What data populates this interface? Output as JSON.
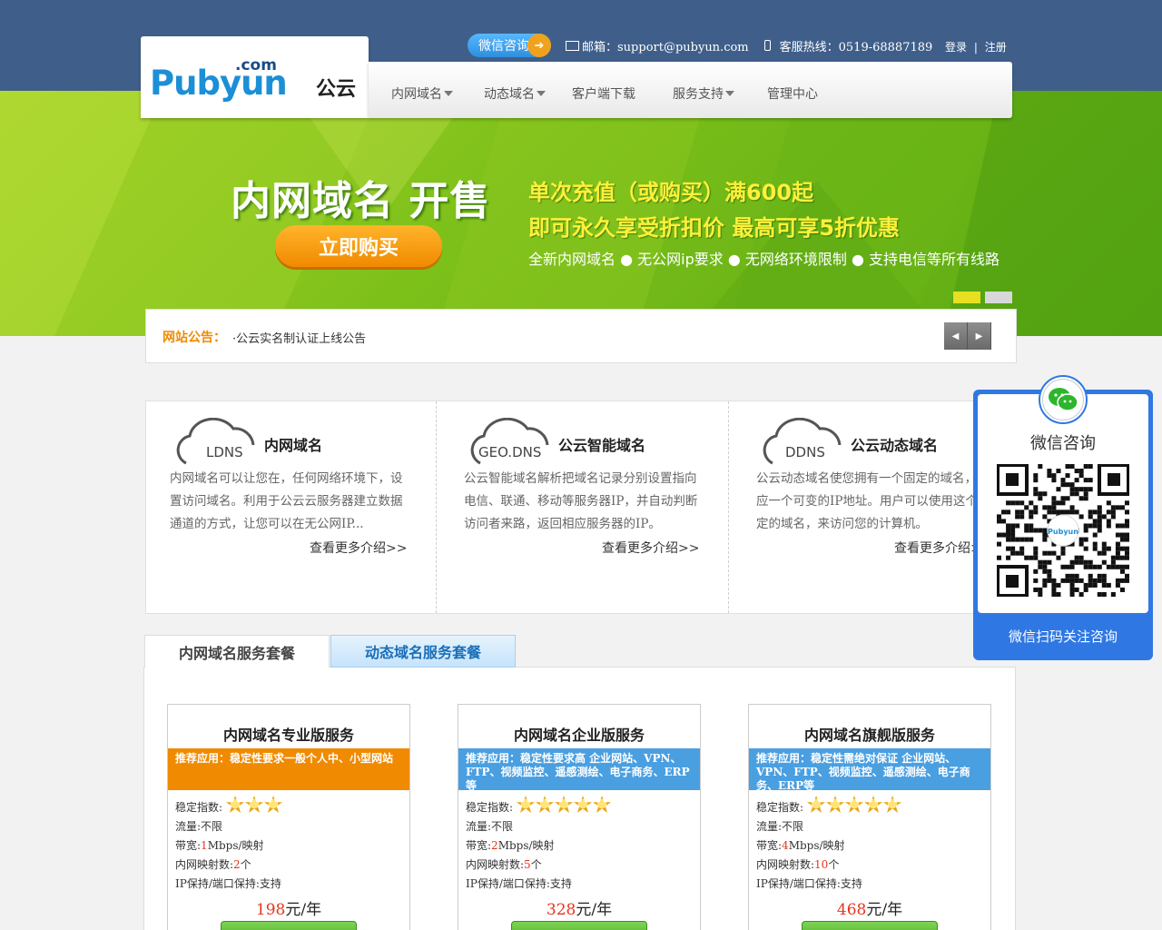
{
  "top": {
    "wechat_consult": "微信咨询",
    "email": "邮箱：support@pubyun.com",
    "hotline": "客服热线：0519-68887189",
    "login": "登录",
    "separator": "|",
    "register": "注册"
  },
  "logo": {
    "com": ".com",
    "main": "Pubyun",
    "cn": "公云"
  },
  "nav": [
    {
      "label": "内网域名",
      "has_dropdown": true
    },
    {
      "label": "动态域名",
      "has_dropdown": true
    },
    {
      "label": "客户端下载",
      "has_dropdown": false
    },
    {
      "label": "服务支持",
      "has_dropdown": true
    },
    {
      "label": "管理中心",
      "has_dropdown": false
    }
  ],
  "banner": {
    "title": "内网域名 开售",
    "buy_button": "立即购买",
    "line1": "单次充值（或购买）满600起",
    "line2": "即可永久享受折扣价 最高可享5折优惠",
    "line3": "全新内网域名 ● 无公网ip要求 ● 无网络环境限制 ● 支持电信等所有线路",
    "slide_count": 2,
    "active_slide": 1
  },
  "notice": {
    "label": "网站公告：",
    "text": "·公云实名制认证上线公告",
    "prev_icon": "caret-left-icon",
    "next_icon": "caret-right-icon"
  },
  "features": [
    {
      "icon_text": "LDNS",
      "title": "内网域名",
      "desc": "内网域名可以让您在，任何网络环境下，设置访问域名。利用于公云云服务器建立数据通道的方式，让您可以在无公网IP...",
      "more": "查看更多介绍>>"
    },
    {
      "icon_text": "GEO.DNS",
      "title": "公云智能域名",
      "desc": "公云智能域名解析把域名记录分别设置指向电信、联通、移动等服务器IP，并自动判断访问者来路，返回相应服务器的IP。",
      "more": "查看更多介绍>>"
    },
    {
      "icon_text": "DDNS",
      "title": "公云动态域名",
      "desc": "公云动态域名使您拥有一个固定的域名，对应一个可变的IP地址。用户可以使用这个固定的域名，来访问您的计算机。",
      "more": "查看更多介绍>>"
    }
  ],
  "tabs": [
    {
      "label": "内网域名服务套餐",
      "active": true
    },
    {
      "label": "动态域名服务套餐",
      "active": false
    }
  ],
  "packages": [
    {
      "title": "内网域名专业版服务",
      "rec": "推荐应用：稳定性要求一般个人中、小型网站",
      "rec_color": "orange",
      "stability_label": "稳定指数:",
      "stars": 3,
      "traffic": "流量:不限",
      "bw_prefix": "带宽:",
      "bw_value": "1",
      "bw_suffix": "Mbps/映射",
      "map_prefix": "内网映射数:",
      "map_value": "2",
      "map_suffix": "个",
      "ip": "IP保持/端口保持:支持",
      "price": "198",
      "unit": "元/年"
    },
    {
      "title": "内网域名企业版服务",
      "rec": "推荐应用：稳定性要求高 企业网站、VPN、FTP、视频监控、遥感测绘、电子商务、ERP等",
      "rec_color": "blue",
      "stability_label": "稳定指数:",
      "stars": 5,
      "traffic": "流量:不限",
      "bw_prefix": "带宽:",
      "bw_value": "2",
      "bw_suffix": "Mbps/映射",
      "map_prefix": "内网映射数:",
      "map_value": "5",
      "map_suffix": "个",
      "ip": "IP保持/端口保持:支持",
      "price": "328",
      "unit": "元/年"
    },
    {
      "title": "内网域名旗舰版服务",
      "rec": "推荐应用：稳定性需绝对保证 企业网站、VPN、FTP、视频监控、遥感测绘、电子商务、ERP等",
      "rec_color": "blue",
      "stability_label": "稳定指数:",
      "stars": 5,
      "traffic": "流量:不限",
      "bw_prefix": "带宽:",
      "bw_value": "4",
      "bw_suffix": "Mbps/映射",
      "map_prefix": "内网映射数:",
      "map_value": "10",
      "map_suffix": "个",
      "ip": "IP保持/端口保持:支持",
      "price": "468",
      "unit": "元/年"
    }
  ],
  "wechat_panel": {
    "title": "微信咨询",
    "qr_label": "Pubyun",
    "footer": "微信扫码关注咨询"
  },
  "colors": {
    "topbar": "#3f5f8a",
    "banner_green": "#7bbf1a",
    "accent_orange": "#f08a00",
    "accent_blue": "#2f78e3",
    "price_red": "#e8331d"
  }
}
